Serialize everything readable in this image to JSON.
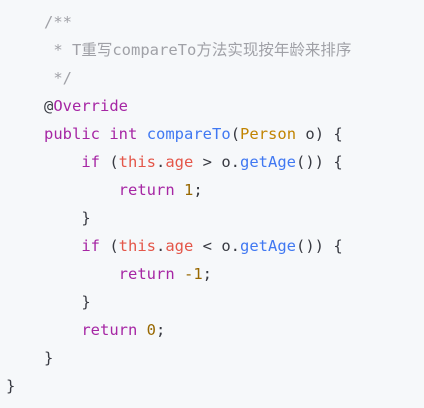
{
  "theme": {
    "background": "#f6f8fa",
    "comment": "#a0a1a7",
    "keyword": "#a626a4",
    "function": "#4078f2",
    "type": "#c18401",
    "variable": "#e45649",
    "number": "#986801",
    "plain": "#383a42"
  },
  "code": {
    "lines": [
      [
        {
          "t": "/**",
          "c": "comment"
        }
      ],
      [
        {
          "t": " * T重写compareTo方法实现按年龄来排序",
          "c": "comment"
        }
      ],
      [
        {
          "t": " */",
          "c": "comment"
        }
      ],
      [
        {
          "t": "@",
          "c": "plain"
        },
        {
          "t": "Override",
          "c": "keyword"
        }
      ],
      [
        {
          "t": "public",
          "c": "keyword"
        },
        {
          "t": " ",
          "c": "plain"
        },
        {
          "t": "int",
          "c": "keyword"
        },
        {
          "t": " ",
          "c": "plain"
        },
        {
          "t": "compareTo",
          "c": "function"
        },
        {
          "t": "(",
          "c": "plain"
        },
        {
          "t": "Person",
          "c": "type"
        },
        {
          "t": " o) {",
          "c": "plain"
        }
      ],
      [
        {
          "t": "    ",
          "c": "plain"
        },
        {
          "t": "if",
          "c": "keyword"
        },
        {
          "t": " (",
          "c": "plain"
        },
        {
          "t": "this",
          "c": "variable"
        },
        {
          "t": ".",
          "c": "plain"
        },
        {
          "t": "age",
          "c": "variable"
        },
        {
          "t": " > o.",
          "c": "plain"
        },
        {
          "t": "getAge",
          "c": "function"
        },
        {
          "t": "()) {",
          "c": "plain"
        }
      ],
      [
        {
          "t": "        ",
          "c": "plain"
        },
        {
          "t": "return",
          "c": "keyword"
        },
        {
          "t": " ",
          "c": "plain"
        },
        {
          "t": "1",
          "c": "number"
        },
        {
          "t": ";",
          "c": "plain"
        }
      ],
      [
        {
          "t": "    }",
          "c": "plain"
        }
      ],
      [
        {
          "t": "    ",
          "c": "plain"
        },
        {
          "t": "if",
          "c": "keyword"
        },
        {
          "t": " (",
          "c": "plain"
        },
        {
          "t": "this",
          "c": "variable"
        },
        {
          "t": ".",
          "c": "plain"
        },
        {
          "t": "age",
          "c": "variable"
        },
        {
          "t": " < o.",
          "c": "plain"
        },
        {
          "t": "getAge",
          "c": "function"
        },
        {
          "t": "()) {",
          "c": "plain"
        }
      ],
      [
        {
          "t": "        ",
          "c": "plain"
        },
        {
          "t": "return",
          "c": "keyword"
        },
        {
          "t": " ",
          "c": "plain"
        },
        {
          "t": "-1",
          "c": "number"
        },
        {
          "t": ";",
          "c": "plain"
        }
      ],
      [
        {
          "t": "    }",
          "c": "plain"
        }
      ],
      [
        {
          "t": "    ",
          "c": "plain"
        },
        {
          "t": "return",
          "c": "keyword"
        },
        {
          "t": " ",
          "c": "plain"
        },
        {
          "t": "0",
          "c": "number"
        },
        {
          "t": ";",
          "c": "plain"
        }
      ],
      [
        {
          "t": "}",
          "c": "plain"
        }
      ],
      [
        {
          "t": "}",
          "c": "plain"
        }
      ]
    ]
  }
}
